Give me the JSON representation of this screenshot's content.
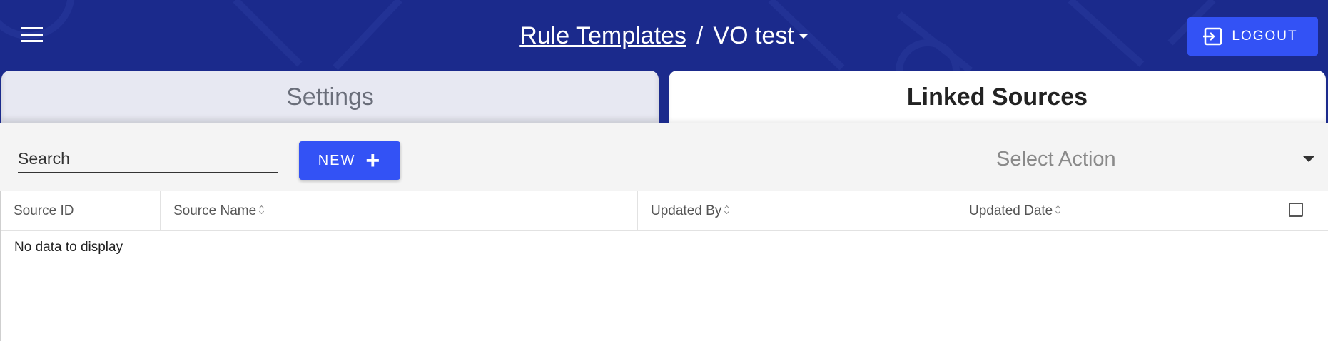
{
  "header": {
    "menu_icon": "hamburger-menu-icon",
    "breadcrumb_link": "Rule Templates",
    "breadcrumb_separator": "/",
    "current_item": "VO test",
    "logout_label": "LOGOUT",
    "logout_icon": "logout-icon",
    "colors": {
      "background": "#1b2a8c",
      "button": "#3352f5"
    }
  },
  "tabs": [
    {
      "label": "Settings",
      "active": false
    },
    {
      "label": "Linked Sources",
      "active": true
    }
  ],
  "toolbar": {
    "search_placeholder": "Search",
    "new_label": "NEW",
    "new_icon": "plus-icon",
    "select_action_placeholder": "Select Action"
  },
  "table": {
    "columns": [
      {
        "label": "Source ID",
        "sortable": false
      },
      {
        "label": "Source Name",
        "sortable": true
      },
      {
        "label": "Updated By",
        "sortable": true
      },
      {
        "label": "Updated Date",
        "sortable": true
      }
    ],
    "empty_message": "No data to display"
  }
}
